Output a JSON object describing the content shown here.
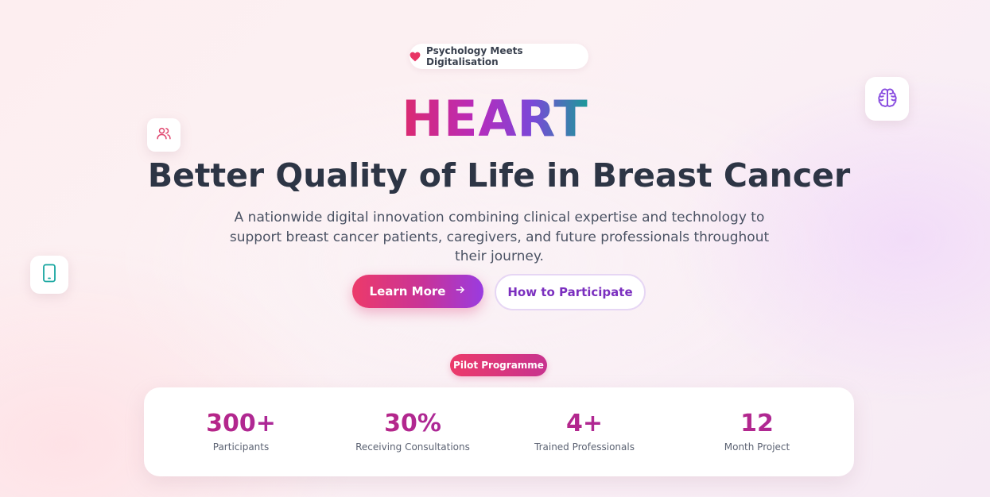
{
  "badge": {
    "icon": "heart-icon",
    "text": "Psychology Meets Digitalisation"
  },
  "floating_icons": [
    "users-icon",
    "brain-icon",
    "tablet-icon"
  ],
  "hero": {
    "title": "HEART",
    "subtitle": "Better Quality of Life in Breast Cancer",
    "description": "A nationwide digital innovation combining clinical expertise and technology to support breast cancer patients, caregivers, and future professionals throughout their journey."
  },
  "buttons": {
    "primary_label": "Learn More",
    "primary_icon": "arrow-right-icon",
    "secondary_label": "How to Participate"
  },
  "pilot": {
    "label": "Pilot Programme"
  },
  "stats": [
    {
      "value": "300+",
      "label": "Participants"
    },
    {
      "value": "30%",
      "label": "Receiving Consultations"
    },
    {
      "value": "4+",
      "label": "Trained Professionals"
    },
    {
      "value": "12",
      "label": "Month Project"
    }
  ],
  "colors": {
    "pink": "#ec3a6a",
    "magenta": "#c025b8",
    "purple": "#7b2fbf",
    "teal": "#1f9a9a",
    "text_dark": "#2d3545"
  }
}
